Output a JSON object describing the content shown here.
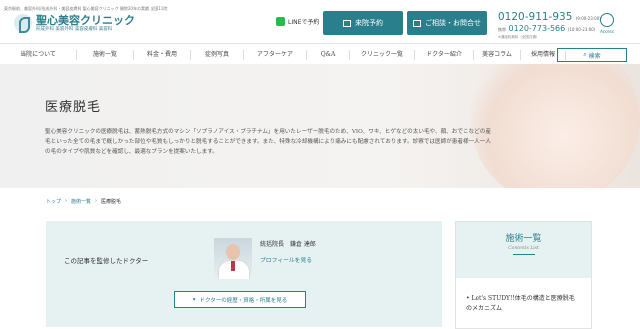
{
  "header": {
    "top_note": "東京駅前、美容外科/形成外科・美容皮膚科 聖心美容クリニック 開院20年の実績 全国11院",
    "logo_name": "聖心美容クリニック",
    "logo_sub": "形成外科 美容外科 美容皮膚科 美容科",
    "line_label": "LINEで予約",
    "reserve_button": "来院予約",
    "consult_button": "ご相談・お問合せ",
    "tel_main": "0120-911-935",
    "tel_main_hours": "(9:00-23:00)",
    "tel_sub_label": "携帯",
    "tel_sub": "0120-773-566",
    "tel_sub_hours": "(10:00-23:00)",
    "tel_note": "※通話料無料（全国共通）",
    "access_label": "Access"
  },
  "nav": {
    "items": [
      "当院について",
      "施術一覧",
      "料金・費用",
      "症例写真",
      "アフターケア",
      "Q&A",
      "クリニック一覧",
      "ドクター紹介",
      "美容コラム",
      "採用情報"
    ],
    "search_label": "検索"
  },
  "hero": {
    "title": "医療脱毛",
    "description": "聖心美容クリニックの医療脱毛は、蓄熱脱毛方式のマシン「ソプラノアイス・プラチナム」を用いたレーザー脱毛のため、VIO、ワキ、ヒゲなどの太い毛や、顔、おでこなどの産毛といった全ての毛まで概しかった部位や毛質もしっかりと脱毛することができます。また、特殊な冷却機構により痛みにも配慮されております。診察では医師が患者様一人一人の毛のタイプや肌質などを確認し、最適なプランを提案いたします。"
  },
  "breadcrumb": [
    "トップ",
    "施術一覧",
    "医療脱毛"
  ],
  "supervisor": {
    "label": "この記事を監修したドクター",
    "doctor_name": "統括院長　鎌倉 達郎",
    "profile_link": "プロフィールを見る",
    "details_button": "ドクターの経歴・資格・所属を見る"
  },
  "sidebar": {
    "title": "施術一覧",
    "subtitle": "Contents List",
    "first_item": "Let's STUDY!!体毛の構造と医療脱毛のメカニズム"
  },
  "colors": {
    "accent": "#2a7f8d",
    "line_green": "#2eb84b",
    "panel": "#e6f1f2"
  }
}
